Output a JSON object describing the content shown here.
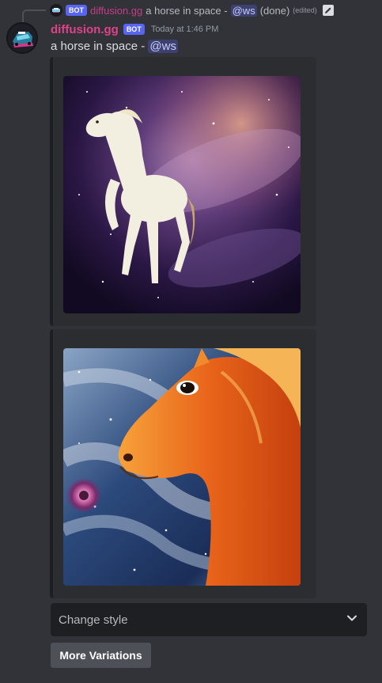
{
  "reply": {
    "bot_tag": "BOT",
    "username": "diffusion.gg",
    "text": "a horse in space -",
    "mention": "@ws",
    "status": "(done)",
    "edited": "(edited)"
  },
  "message": {
    "username": "diffusion.gg",
    "bot_tag": "BOT",
    "timestamp": "Today at 1:46 PM",
    "text": "a horse in space -",
    "mention": "@ws"
  },
  "embeds": [
    {
      "image": "white horse galloping through purple nebula"
    },
    {
      "image": "orange horse head painting in swirling blue space"
    }
  ],
  "components": {
    "select_placeholder": "Change style",
    "button_label": "More Variations"
  },
  "colors": {
    "background": "#313338",
    "embed_background": "#2b2d31",
    "username": "#e0418a",
    "bot_tag": "#5865f2",
    "button": "#4e5058"
  },
  "icons": {
    "edit": "pencil-icon",
    "dropdown": "chevron-down-icon"
  }
}
